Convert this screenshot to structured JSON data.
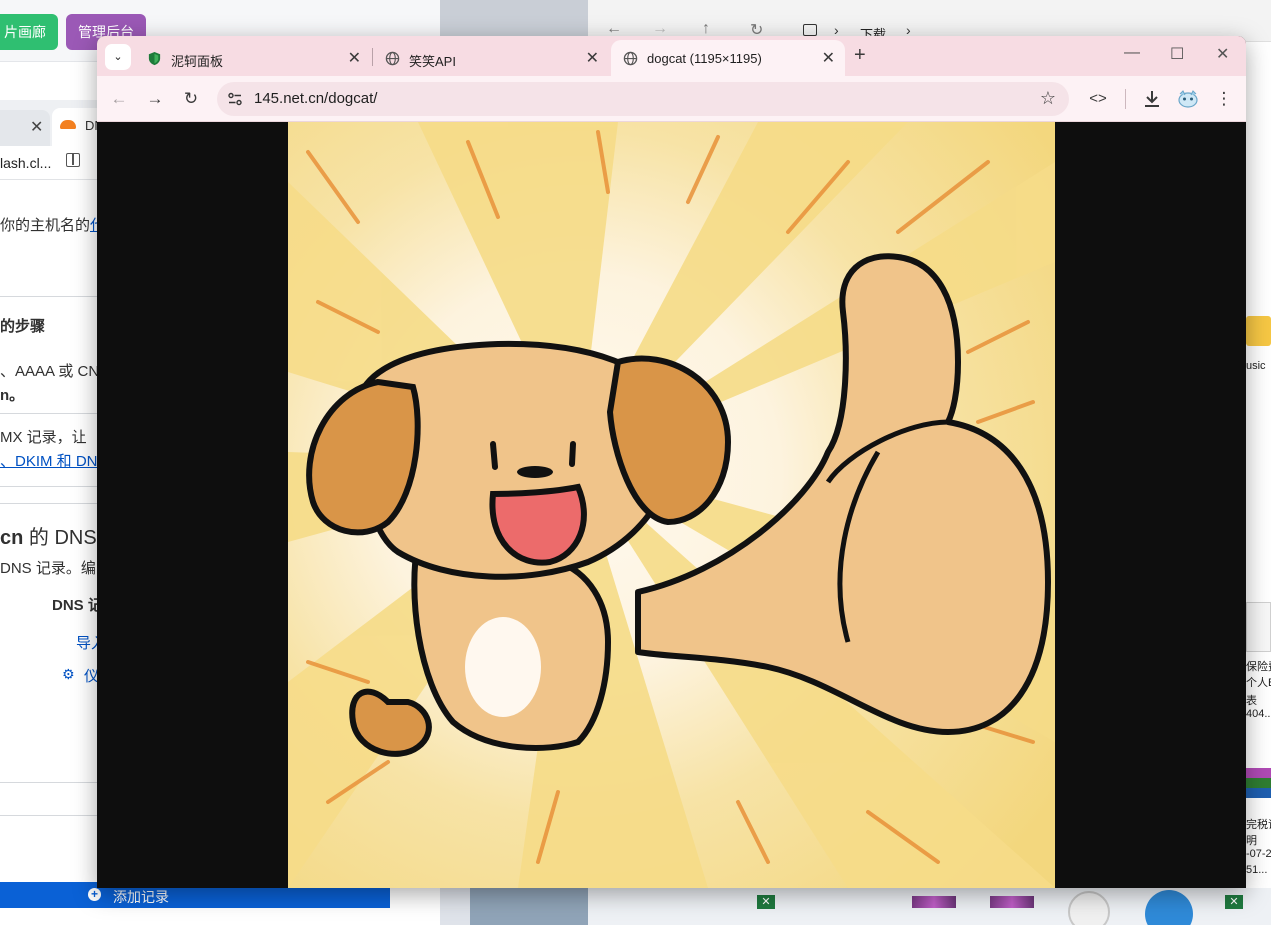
{
  "background_left": {
    "button_gallery": "片画廊",
    "button_admin": "管理后台",
    "tab_title": "DN",
    "address_fragment": "lash.cl...",
    "text_hostname": "你的主机名的",
    "text_hostname_link": "代",
    "heading_steps": "的步骤",
    "text_aaaa": "、AAAA 或 CN",
    "text_n": "n。",
    "text_mx": "MX 记录，让",
    "link_dkim": "、DKIM 和 DN",
    "heading_dns_prefix": "cn",
    "heading_dns_suffix": " 的 DNS",
    "text_dns_records": "DNS 记录。编",
    "label_dns": "DNS 记",
    "link_import": "导入",
    "link_gear_label": "仪",
    "add_record_label": "添加记录"
  },
  "background_right": {
    "breadcrumb_download": "下载",
    "desktop_label_music": "usic",
    "desktop_file_1_line1": "保险费",
    "desktop_file_1_line2": "个人B",
    "desktop_file_1_line3": "表",
    "desktop_file_1_line4": "404...",
    "desktop_file_2_line1": "完税证",
    "desktop_file_2_line2": "明",
    "desktop_file_2_line3": "-07-2",
    "desktop_file_2_line4": "51..."
  },
  "browser": {
    "tabs": [
      {
        "title": "泥轲面板",
        "favicon": "shield-icon",
        "active": false
      },
      {
        "title": "笑笑API",
        "favicon": "globe-icon",
        "active": false
      },
      {
        "title": "dogcat (1195×1195)",
        "favicon": "globe-icon",
        "active": true
      }
    ],
    "url": "145.net.cn/dogcat/",
    "icons": {
      "back": "back-arrow-icon",
      "forward": "forward-arrow-icon",
      "reload": "reload-icon",
      "site_info": "tune-icon",
      "bookmark": "star-icon",
      "devtools": "code-icon",
      "download": "download-icon",
      "extension": "extension-icon",
      "menu": "kebab-menu-icon"
    },
    "colors": {
      "tab_strip": "#f7dce3",
      "active_tab": "#fdf2f5",
      "viewport_bg": "#0e0e0e"
    }
  },
  "image": {
    "subject": "cartoon puppy giving thumbs up on radiating yellow background"
  }
}
